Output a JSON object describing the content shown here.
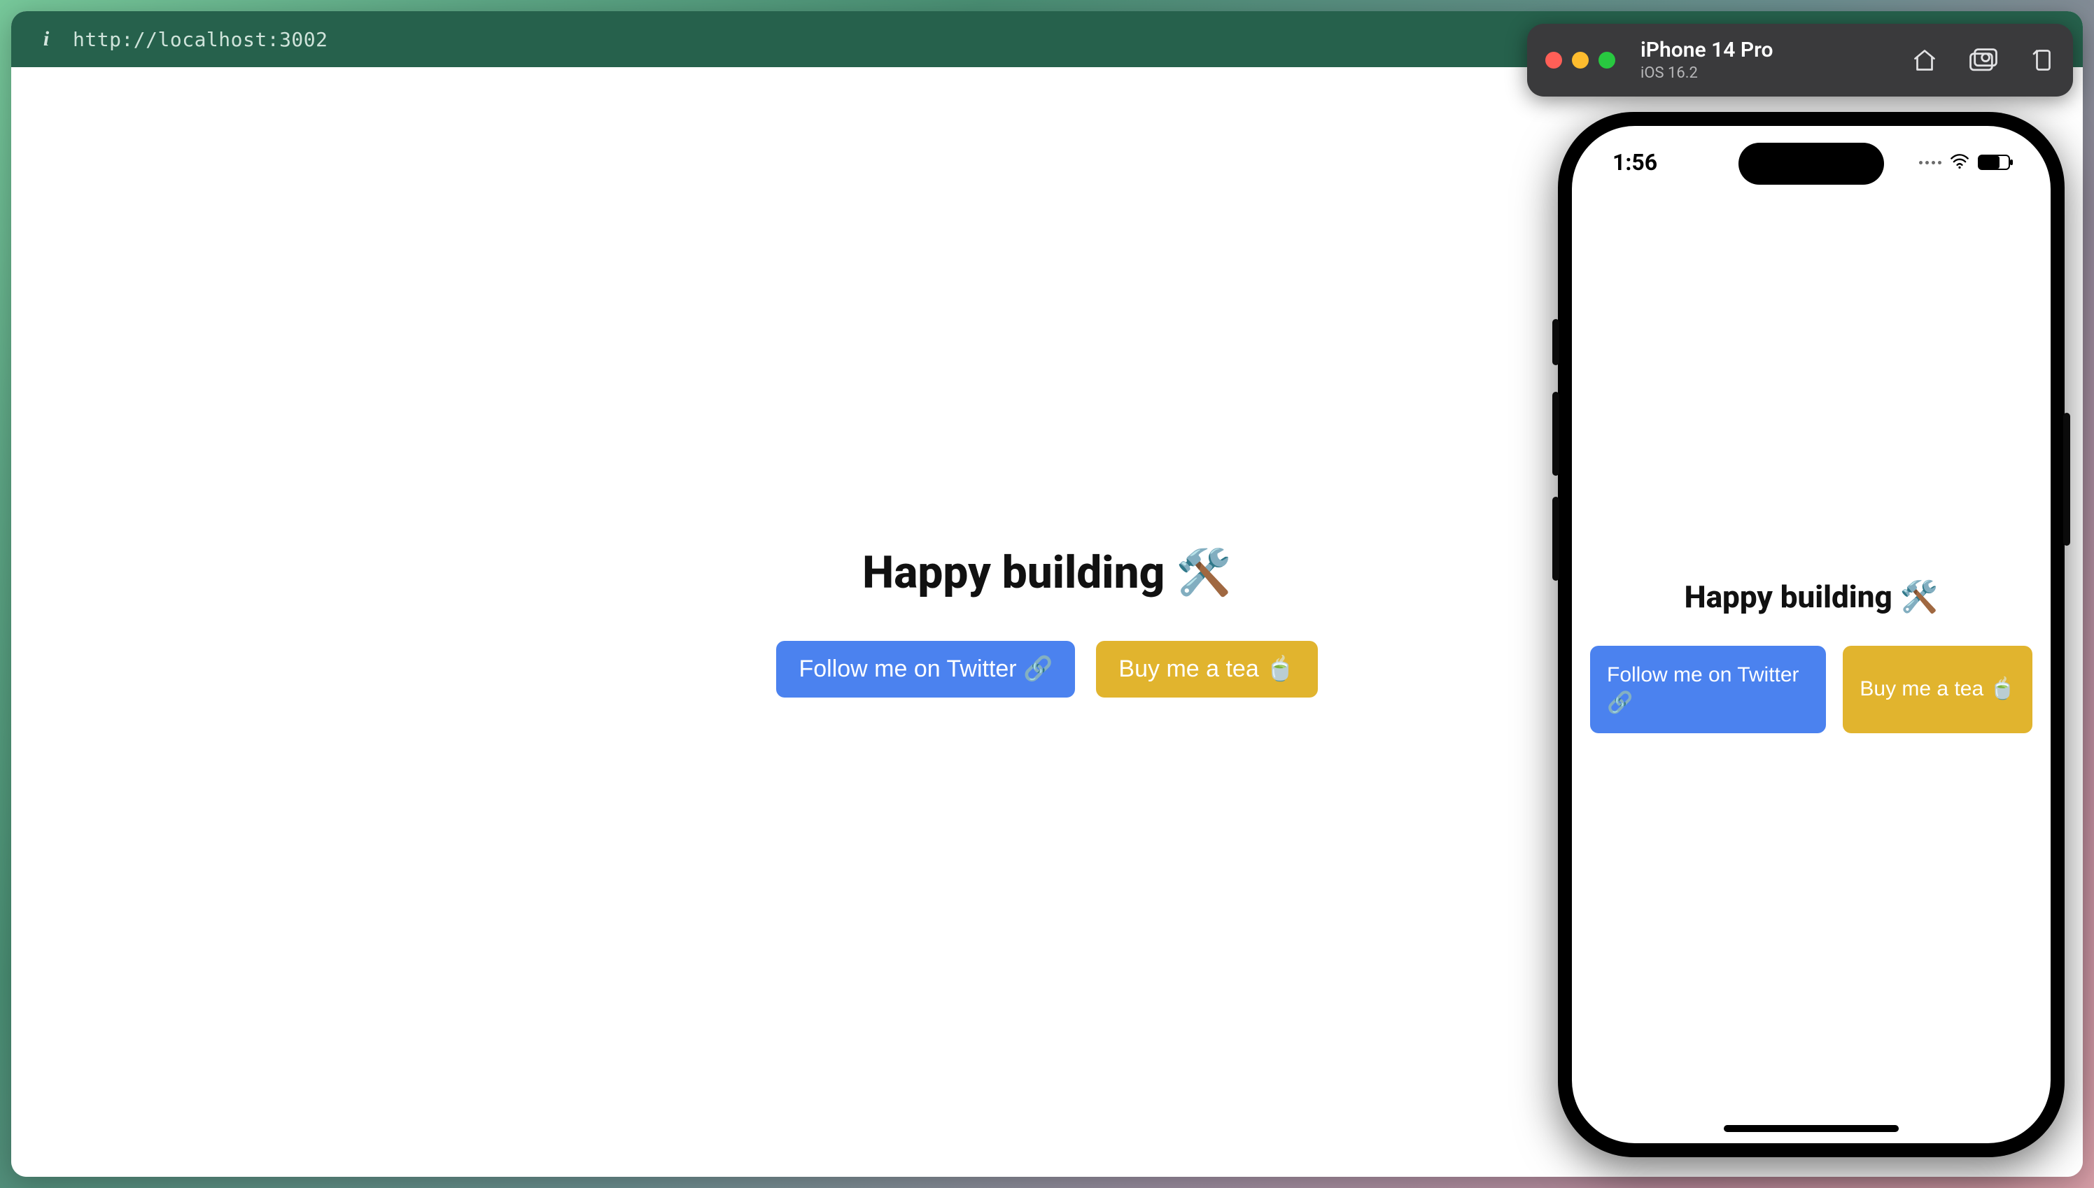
{
  "address_bar": {
    "url": "http://localhost:3002"
  },
  "main_page": {
    "heading": "Happy building 🛠️",
    "buttons": {
      "twitter": "Follow me on Twitter 🔗",
      "tea": "Buy me a tea 🍵"
    }
  },
  "simulator": {
    "device": "iPhone 14 Pro",
    "os": "iOS 16.2",
    "status_time": "1:56"
  },
  "iphone_page": {
    "heading": "Happy building 🛠️",
    "buttons": {
      "twitter": "Follow me on Twitter 🔗",
      "tea": "Buy me a tea 🍵"
    }
  }
}
